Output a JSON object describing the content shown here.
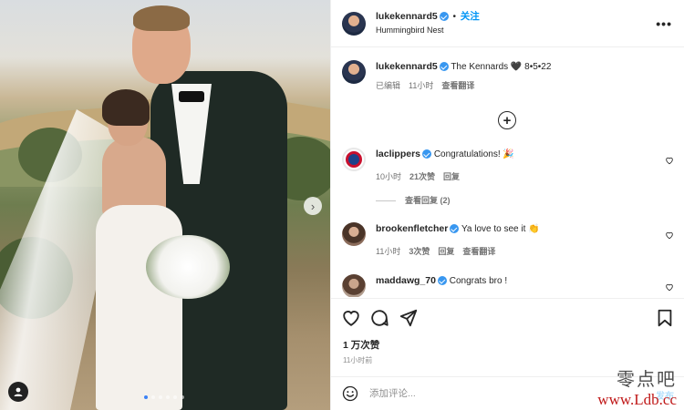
{
  "post": {
    "author": "lukekennard5",
    "follow_label": "关注",
    "separator": "•",
    "location": "Hummingbird Nest",
    "more_label": "•••"
  },
  "caption": {
    "username": "lukekennard5",
    "text": "The Kennards",
    "emoji": "🖤",
    "date_text": "8•5•22",
    "edited": "已编辑",
    "time": "11小时",
    "translate": "查看翻译"
  },
  "load_more": "+",
  "comments": [
    {
      "username": "laclippers",
      "text": "Congratulations!",
      "emoji": "🎉",
      "time": "10小时",
      "likes": "21次赞",
      "reply": "回复",
      "view_replies": "查看回复 (2)"
    },
    {
      "username": "brookenfletcher",
      "text": "Ya love to see it",
      "emoji": "👏",
      "time": "11小时",
      "likes": "3次赞",
      "reply": "回复",
      "translate": "查看翻译"
    },
    {
      "username": "maddawg_70",
      "text": "Congrats bro !"
    }
  ],
  "likes_summary": "1 万次赞",
  "post_time": "11小时前",
  "add_comment": {
    "placeholder": "添加评论...",
    "post_label": "发布"
  },
  "carousel": {
    "slide_count": 6,
    "active_index": 0
  },
  "watermark": {
    "chinese": "零点吧",
    "url": "www.Ldb.cc"
  },
  "colors": {
    "accent": "#0095f6",
    "verified": "#3897f0",
    "muted": "#737373"
  }
}
